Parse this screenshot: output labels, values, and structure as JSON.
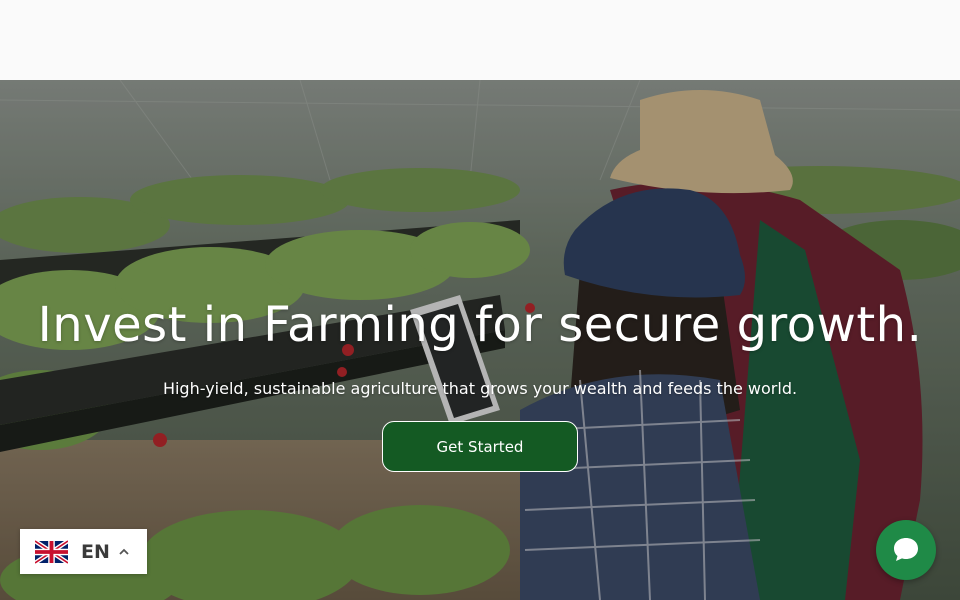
{
  "hero": {
    "title": "Invest in Farming for secure growth.",
    "subtitle": "High-yield, sustainable agriculture that grows your wealth and feeds the world.",
    "cta_label": "Get Started",
    "image_subject": "greenhouse-strawberry-farmers-photo"
  },
  "language_switcher": {
    "code": "EN",
    "flag_icon": "uk-flag-icon",
    "caret_icon": "chevron-up-icon"
  },
  "chat_widget": {
    "icon": "chat-bubble-icon"
  },
  "colors": {
    "topbar_bg": "#fafafa",
    "cta_bg": "#145a23",
    "chat_bg": "#1f8a47",
    "text_on_hero": "#ffffff"
  }
}
